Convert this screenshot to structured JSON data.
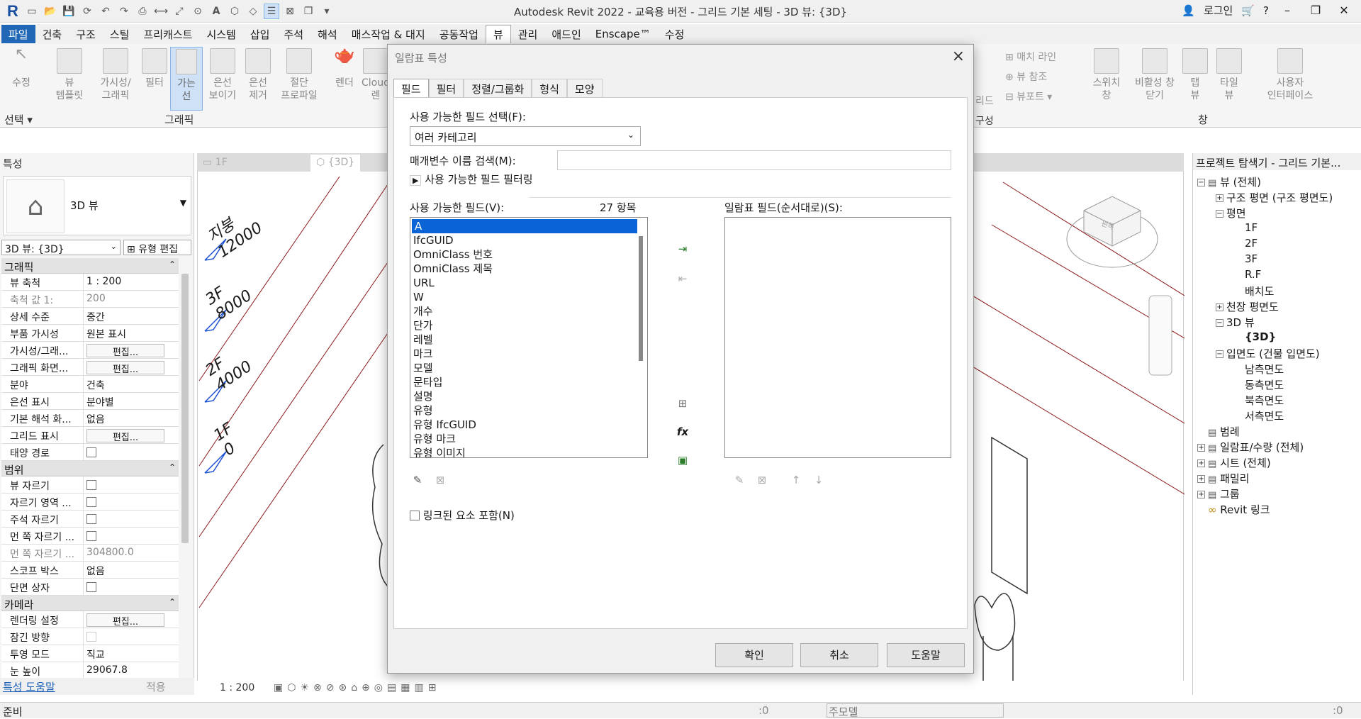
{
  "app": {
    "title": "Autodesk Revit 2022 - 교육용 버전 - 그리드 기본 세팅 - 3D 뷰: {3D}",
    "login": "로그인"
  },
  "menu": [
    "파일",
    "건축",
    "구조",
    "스틸",
    "프리캐스트",
    "시스템",
    "삽입",
    "주석",
    "해석",
    "매스작업 & 대지",
    "공동작업",
    "뷰",
    "관리",
    "애드인",
    "Enscape™",
    "수정"
  ],
  "ribbon": {
    "select": "선택",
    "modify": "수정",
    "view_template": "뷰\n템플릿",
    "vis_graphics": "가시성/\n그래픽",
    "filter": "필터",
    "thin_lines": "가는\n선",
    "show_hidden": "은선\n보이기",
    "remove_hidden": "은선\n제거",
    "cut_profile": "절단\n프로파일",
    "render": "렌더",
    "cloud": "Cloud\n렌",
    "graphics_panel": "그래픽",
    "match_line": "매치 라인",
    "view_ref": "뷰 참조",
    "viewport": "뷰포트",
    "switch_windows": "스위치\n창",
    "close_inactive": "비활성 창\n닫기",
    "tab_views": "탭\n뷰",
    "tile_views": "타일\n뷰",
    "user_interface": "사용자\n인터페이스",
    "window_panel": "창",
    "grid_partial": "리드",
    "composition_partial": "구성"
  },
  "properties": {
    "header": "특성",
    "type_name": "3D 뷰",
    "view_selector": "3D 뷰: {3D}",
    "edit_type": "유형 편집",
    "groups": [
      {
        "name": "그래픽",
        "rows": [
          [
            "뷰 축척",
            "1 : 200",
            ""
          ],
          [
            "축척 값    1:",
            "200",
            "dim"
          ],
          [
            "상세 수준",
            "중간",
            ""
          ],
          [
            "부품 가시성",
            "원본 표시",
            ""
          ],
          [
            "가시성/그래...",
            "편집...",
            "btn"
          ],
          [
            "그래픽 화면...",
            "편집...",
            "btn"
          ],
          [
            "분야",
            "건축",
            ""
          ],
          [
            "은선 표시",
            "분야별",
            ""
          ],
          [
            "기본 해석 화...",
            "없음",
            ""
          ],
          [
            "그리드 표시",
            "편집...",
            "btn"
          ],
          [
            "태양 경로",
            "",
            "cb"
          ]
        ]
      },
      {
        "name": "범위",
        "rows": [
          [
            "뷰 자르기",
            "",
            "cb"
          ],
          [
            "자르기 영역 ...",
            "",
            "cb"
          ],
          [
            "주석 자르기",
            "",
            "cb"
          ],
          [
            "먼 쪽 자르기 ...",
            "",
            "cb"
          ],
          [
            "먼 쪽 자르기 ...",
            "304800.0",
            "dim"
          ],
          [
            "스코프 박스",
            "없음",
            ""
          ],
          [
            "단면 상자",
            "",
            "cb"
          ]
        ]
      },
      {
        "name": "카메라",
        "rows": [
          [
            "렌더링 설정",
            "편집...",
            "btn"
          ],
          [
            "잠긴 방향",
            "",
            "cbdim"
          ],
          [
            "투영 모드",
            "직교",
            ""
          ],
          [
            "눈 높이",
            "29067.8",
            ""
          ]
        ]
      }
    ],
    "help_link": "특성 도움말",
    "apply": "적용"
  },
  "view": {
    "tab1": "1F",
    "tab2": "{3D}",
    "scale": "1 : 200",
    "levels": [
      {
        "name": "지붕",
        "elev": "12000"
      },
      {
        "name": "3F",
        "elev": "8000"
      },
      {
        "name": "2F",
        "elev": "4000"
      },
      {
        "name": "1F",
        "elev": "0"
      }
    ],
    "viewcube_label": "왼쪽"
  },
  "browser": {
    "header": "프로젝트 탐색기 - 그리드 기본...",
    "nodes": [
      "뷰 (전체)",
      "구조 평면 (구조 평면도)",
      "평면",
      "1F",
      "2F",
      "3F",
      "R.F",
      "배치도",
      "천장 평면도",
      "3D 뷰",
      "{3D}",
      "입면도 (건물 입면도)",
      "남측면도",
      "동측면도",
      "북측면도",
      "서측면도",
      "범례",
      "일람표/수량 (전체)",
      "시트 (전체)",
      "패밀리",
      "그룹",
      "Revit 링크"
    ]
  },
  "status": {
    "ready": "준비",
    "main_model": "주모델",
    "zero1": ":0",
    "zero2": ":0"
  },
  "dialog": {
    "title": "일람표 특성",
    "tabs": [
      "필드",
      "필터",
      "정렬/그룹화",
      "형식",
      "모양"
    ],
    "select_fields_label": "사용 가능한 필드 선택(F):",
    "category": "여러 카테고리",
    "search_label": "매개변수 이름 검색(M):",
    "search_value": "",
    "filter_toggle": "사용 가능한 필드 필터링",
    "available_label": "사용 가능한 필드(V):",
    "count": "27 항목",
    "available_fields": [
      "A",
      "IfcGUID",
      "OmniClass 번호",
      "OmniClass 제목",
      "URL",
      "W",
      "개수",
      "단가",
      "레벨",
      "마크",
      "모델",
      "문타입",
      "설명",
      "유형",
      "유형 IfcGUID",
      "유형 마크",
      "유형 이미지"
    ],
    "schedule_label": "일람표 필드(순서대로)(S):",
    "linked_label": "링크된 요소 포함(N)",
    "ok": "확인",
    "cancel": "취소",
    "help": "도움말"
  }
}
